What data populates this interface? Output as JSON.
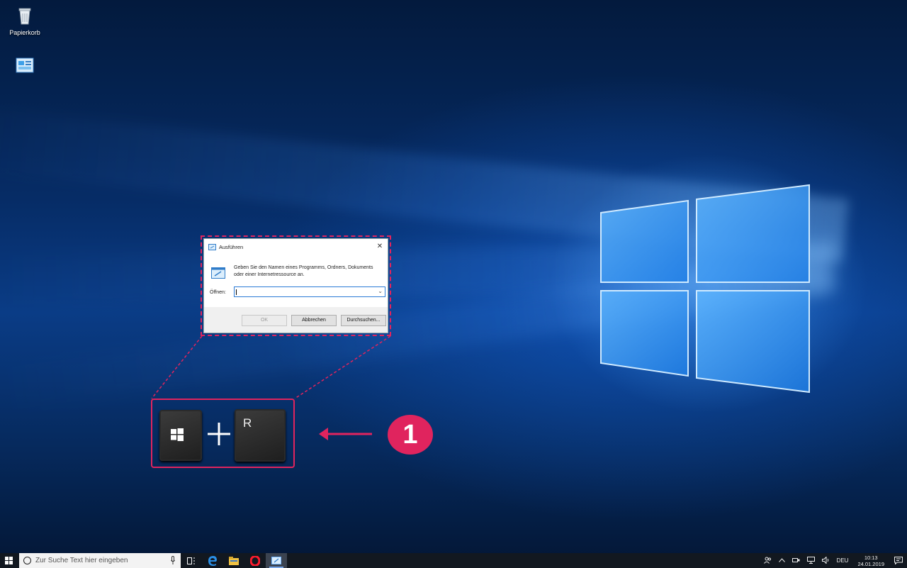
{
  "desktop": {
    "icons": [
      {
        "label": "Papierkorb",
        "icon": "recycle-bin-icon"
      },
      {
        "label": "",
        "icon": "control-panel-icon"
      }
    ]
  },
  "run_dialog": {
    "title": "Ausführen",
    "description": "Geben Sie den Namen eines Programms, Ordners, Dokuments oder einer Internetressource an.",
    "open_label": "Öffnen:",
    "open_value": "",
    "ok_label": "OK",
    "cancel_label": "Abbrechen",
    "browse_label": "Durchsuchen..."
  },
  "shortcut": {
    "key_r_label": "R",
    "step_number": "1",
    "accent_color": "#e0245e"
  },
  "taskbar": {
    "search_placeholder": "Zur Suche Text hier eingeben",
    "language": "DEU",
    "time": "10:13",
    "date": "24.01.2019"
  }
}
